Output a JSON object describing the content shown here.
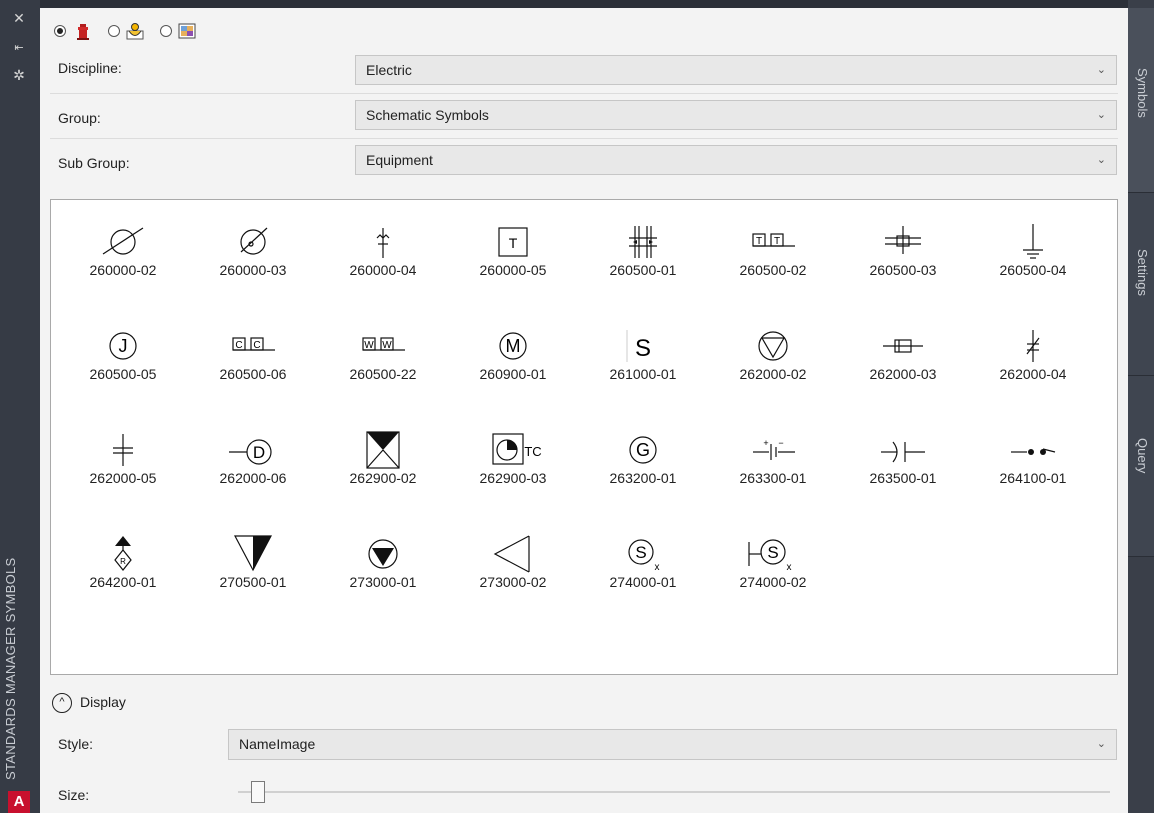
{
  "palette_title": "STANDARDS MANAGER SYMBOLS",
  "left_strip": {
    "close": "✕",
    "autohide": "⇤",
    "properties": "✲",
    "app_logo": "A"
  },
  "right_tabs": [
    "Symbols",
    "Settings",
    "Query"
  ],
  "source_options": [
    {
      "icon": "hydrant-icon",
      "selected": true
    },
    {
      "icon": "block-library-icon",
      "selected": false
    },
    {
      "icon": "image-library-icon",
      "selected": false
    }
  ],
  "discipline": {
    "label": "Discipline:",
    "value": "Electric"
  },
  "group": {
    "label": "Group:",
    "value": "Schematic Symbols"
  },
  "sub_group": {
    "label": "Sub Group:",
    "value": "Equipment"
  },
  "symbols": [
    "260000-02",
    "260000-03",
    "260000-04",
    "260000-05",
    "260500-01",
    "260500-02",
    "260500-03",
    "260500-04",
    "260500-05",
    "260500-06",
    "260500-22",
    "260900-01",
    "261000-01",
    "262000-02",
    "262000-03",
    "262000-04",
    "262000-05",
    "262000-06",
    "262900-02",
    "262900-03",
    "263200-01",
    "263300-01",
    "263500-01",
    "264100-01",
    "264200-01",
    "270500-01",
    "273000-01",
    "273000-02",
    "274000-01",
    "274000-02"
  ],
  "symbol_glyph_text": {
    "t_box": "T",
    "tt": "T",
    "j": "J",
    "cc": "C",
    "ww": "W",
    "m": "M",
    "s": "S",
    "d": "D",
    "tc": "TC",
    "g": "G",
    "r": "R",
    "x": "x",
    "plus": "+",
    "minus": "−"
  },
  "display": {
    "toggle_label": "Display",
    "style_label": "Style:",
    "style_value": "NameImage",
    "size_label": "Size:",
    "size_fraction": 0.03
  },
  "chevron": "⌄",
  "collapse_glyph": "^"
}
